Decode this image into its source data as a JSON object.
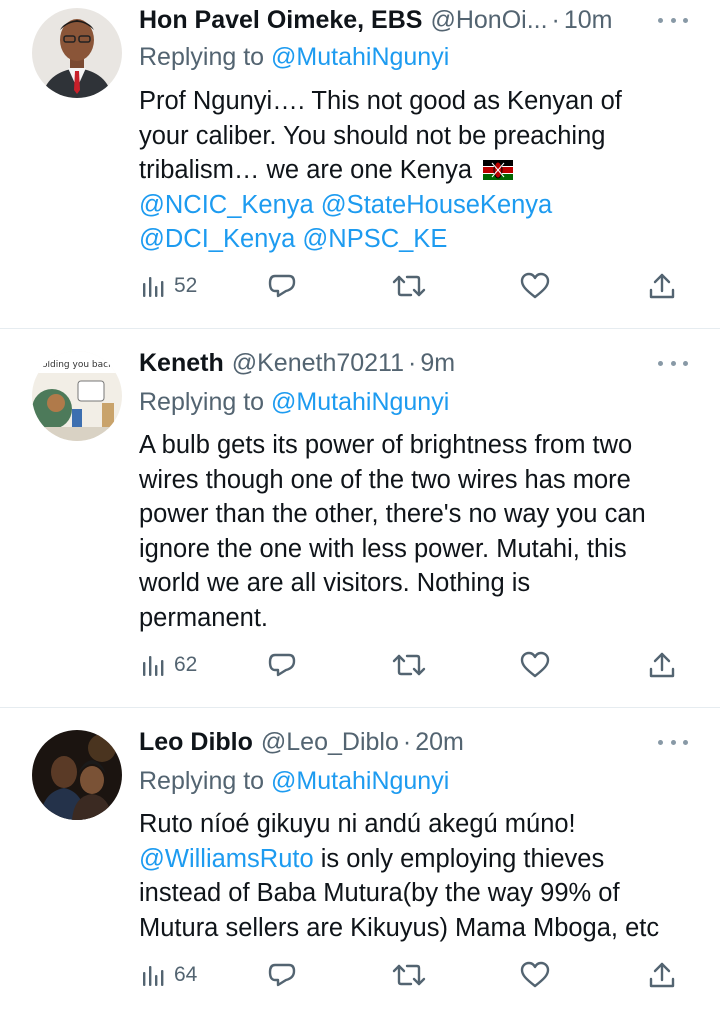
{
  "colors": {
    "link": "#1d9bf0",
    "secondary": "#536471",
    "primary": "#0f1419",
    "divider": "#e6ecf0"
  },
  "tweets": [
    {
      "name": "Hon Pavel Oimeke, EBS",
      "handle": "@HonOi...",
      "sep": "·",
      "time": "10m",
      "replying_prefix": "Replying to",
      "replying_to": "@MutahiNgunyi",
      "lines": [
        "Prof Ngunyi…. This not good as Kenyan of",
        "your caliber. You should not be preaching",
        "tribalism… we are one Kenya"
      ],
      "mentions_line1": [
        "@NCIC_Kenya",
        "@StateHouseKenya"
      ],
      "mentions_line2": [
        "@DCI_Kenya",
        "@NPSC_KE"
      ],
      "emoji": "kenya-flag-emoji",
      "views": "52"
    },
    {
      "name": "Keneth",
      "handle": "@Keneth70211",
      "sep": "·",
      "time": "9m",
      "replying_prefix": "Replying to",
      "replying_to": "@MutahiNgunyi",
      "lines": [
        "A bulb gets its power of brightness from two",
        "wires though one of the two wires has more",
        "power than the other, there's no way you can",
        "ignore the one with less power. Mutahi, this",
        "world we are all visitors. Nothing is",
        "permanent."
      ],
      "avatar_text": "olding you back",
      "views": "62"
    },
    {
      "name": "Leo Diblo",
      "handle": "@Leo_Diblo",
      "sep": "·",
      "time": "20m",
      "replying_prefix": "Replying to",
      "replying_to": "@MutahiNgunyi",
      "line1": "Ruto níoé gikuyu ni andú akegú múno!",
      "line2_mention": "@WilliamsRuto",
      "line2_rest": " is only employing thieves",
      "line3": "instead of Baba Mutura(by the way 99% of",
      "line4": "Mutura sellers are Kikuyus) Mama Mboga, etc",
      "views": "64"
    }
  ]
}
